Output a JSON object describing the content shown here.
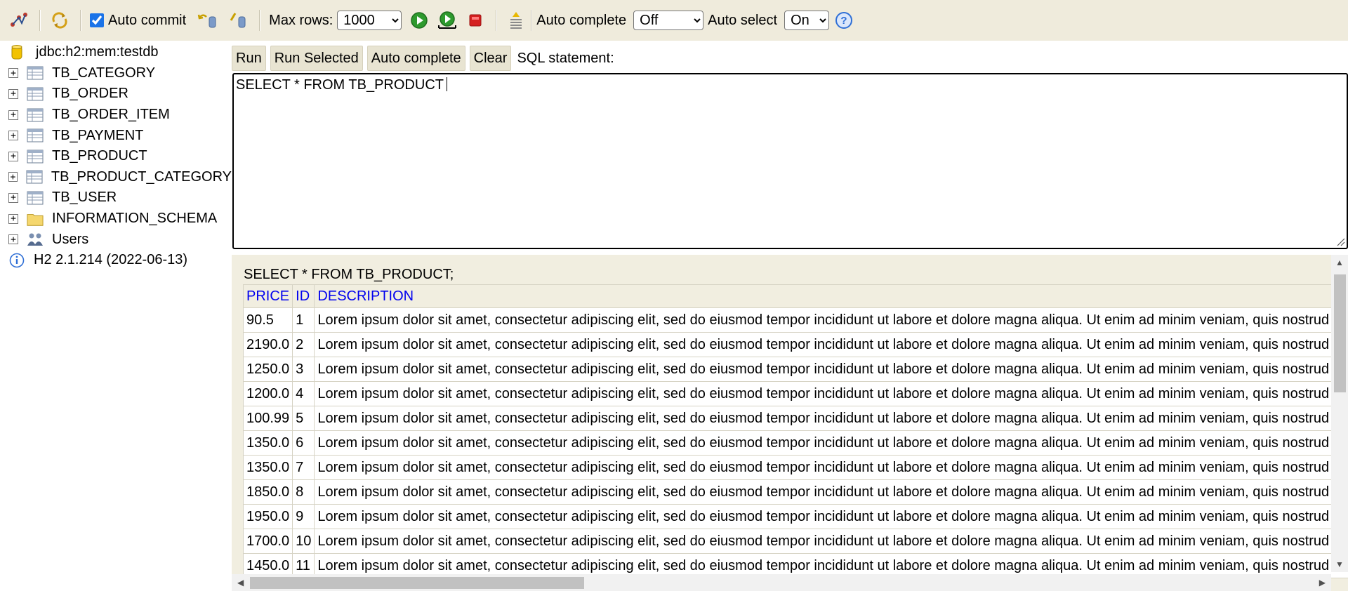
{
  "toolbar": {
    "auto_commit_label": "Auto commit",
    "auto_commit_checked": true,
    "max_rows_label": "Max rows:",
    "max_rows_value": "1000",
    "auto_complete_label": "Auto complete",
    "auto_complete_value": "Off",
    "auto_select_label": "Auto select",
    "auto_select_value": "On"
  },
  "tree": {
    "connection": "jdbc:h2:mem:testdb",
    "tables": [
      "TB_CATEGORY",
      "TB_ORDER",
      "TB_ORDER_ITEM",
      "TB_PAYMENT",
      "TB_PRODUCT",
      "TB_PRODUCT_CATEGORY",
      "TB_USER"
    ],
    "schema": "INFORMATION_SCHEMA",
    "users": "Users",
    "version": "H2 2.1.214 (2022-06-13)"
  },
  "buttons": {
    "run": "Run",
    "run_selected": "Run Selected",
    "auto_complete": "Auto complete",
    "clear": "Clear",
    "sql_caption": "SQL statement:"
  },
  "editor": {
    "text": "SELECT * FROM TB_PRODUCT"
  },
  "results": {
    "query": "SELECT * FROM TB_PRODUCT;",
    "columns": [
      "PRICE",
      "ID",
      "DESCRIPTION"
    ],
    "rows": [
      [
        "90.5",
        "1",
        "Lorem ipsum dolor sit amet, consectetur adipiscing elit, sed do eiusmod tempor incididunt ut labore et dolore magna aliqua. Ut enim ad minim veniam, quis nostrud ex"
      ],
      [
        "2190.0",
        "2",
        "Lorem ipsum dolor sit amet, consectetur adipiscing elit, sed do eiusmod tempor incididunt ut labore et dolore magna aliqua. Ut enim ad minim veniam, quis nostrud ex"
      ],
      [
        "1250.0",
        "3",
        "Lorem ipsum dolor sit amet, consectetur adipiscing elit, sed do eiusmod tempor incididunt ut labore et dolore magna aliqua. Ut enim ad minim veniam, quis nostrud ex"
      ],
      [
        "1200.0",
        "4",
        "Lorem ipsum dolor sit amet, consectetur adipiscing elit, sed do eiusmod tempor incididunt ut labore et dolore magna aliqua. Ut enim ad minim veniam, quis nostrud ex"
      ],
      [
        "100.99",
        "5",
        "Lorem ipsum dolor sit amet, consectetur adipiscing elit, sed do eiusmod tempor incididunt ut labore et dolore magna aliqua. Ut enim ad minim veniam, quis nostrud ex"
      ],
      [
        "1350.0",
        "6",
        "Lorem ipsum dolor sit amet, consectetur adipiscing elit, sed do eiusmod tempor incididunt ut labore et dolore magna aliqua. Ut enim ad minim veniam, quis nostrud ex"
      ],
      [
        "1350.0",
        "7",
        "Lorem ipsum dolor sit amet, consectetur adipiscing elit, sed do eiusmod tempor incididunt ut labore et dolore magna aliqua. Ut enim ad minim veniam, quis nostrud ex"
      ],
      [
        "1850.0",
        "8",
        "Lorem ipsum dolor sit amet, consectetur adipiscing elit, sed do eiusmod tempor incididunt ut labore et dolore magna aliqua. Ut enim ad minim veniam, quis nostrud ex"
      ],
      [
        "1950.0",
        "9",
        "Lorem ipsum dolor sit amet, consectetur adipiscing elit, sed do eiusmod tempor incididunt ut labore et dolore magna aliqua. Ut enim ad minim veniam, quis nostrud ex"
      ],
      [
        "1700.0",
        "10",
        "Lorem ipsum dolor sit amet, consectetur adipiscing elit, sed do eiusmod tempor incididunt ut labore et dolore magna aliqua. Ut enim ad minim veniam, quis nostrud ex"
      ],
      [
        "1450.0",
        "11",
        "Lorem ipsum dolor sit amet, consectetur adipiscing elit, sed do eiusmod tempor incididunt ut labore et dolore magna aliqua. Ut enim ad minim veniam, quis nostrud ex"
      ]
    ]
  },
  "icons": {
    "disconnect": "disconnect-icon",
    "refresh": "refresh-icon",
    "rollback": "rollback-icon",
    "commit": "commit-icon",
    "run": "run-icon",
    "run_selected": "run-selected-icon",
    "stop": "stop-icon",
    "history": "history-icon",
    "help": "help-icon"
  },
  "colors": {
    "toolbar_bg": "#efebdc",
    "link": "#0000ee",
    "run_green": "#2e9a2e",
    "stop_red": "#d42020"
  }
}
